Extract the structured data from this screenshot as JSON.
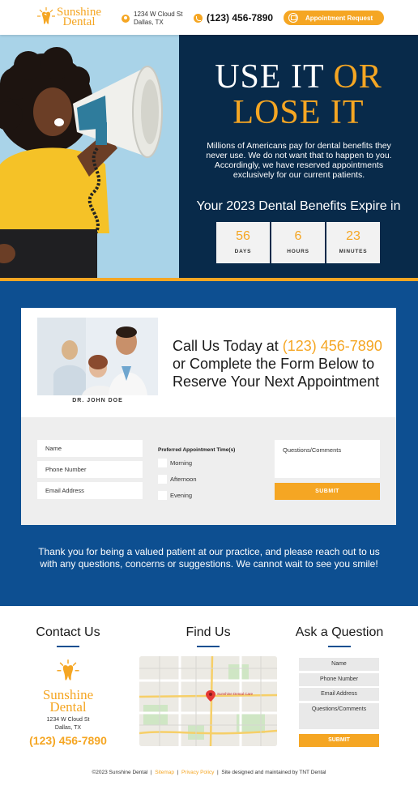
{
  "header": {
    "logo_line1": "Sunshine",
    "logo_line2": "Dental",
    "address_line1": "1234 W Cloud St",
    "address_line2": "Dallas, TX",
    "phone": "(123) 456-7890",
    "appointment_button": "Appointment Request"
  },
  "hero": {
    "title_part1": "USE IT ",
    "title_part2": "OR",
    "title_part3": "LOSE IT",
    "body": "Millions of Americans pay for dental benefits they never use. We do not want that to happen to you. Accordingly, we have reserved appointments exclusively for our current patients.",
    "expire_text": "Your 2023 Dental Benefits Expire in",
    "countdown": [
      {
        "value": "56",
        "label": "DAYS"
      },
      {
        "value": "6",
        "label": "HOURS"
      },
      {
        "value": "23",
        "label": "MINUTES"
      }
    ]
  },
  "appointment": {
    "doctor_label": "DR. JOHN DOE",
    "heading_prefix": "Call Us Today at ",
    "heading_phone": "(123) 456-7890",
    "heading_rest": "or Complete the Form Below to Reserve Your Next Appointment",
    "form": {
      "name_placeholder": "Name",
      "phone_placeholder": "Phone Number",
      "email_placeholder": "Email Address",
      "pref_title": "Preferred Appointment Time(s)",
      "options": [
        "Morning",
        "Afternoon",
        "Evening"
      ],
      "comments_placeholder": "Questions/Comments",
      "submit": "SUBMIT"
    },
    "thanks": "Thank you for being a valued patient at our practice, and please reach out to us with any questions, concerns or suggestions. We cannot wait to see you smile!"
  },
  "contact": {
    "title": "Contact Us",
    "logo_line1": "Sunshine",
    "logo_line2": "Dental",
    "address_line1": "1234 W Cloud St",
    "address_line2": "Dallas, TX",
    "phone": "(123) 456-7890"
  },
  "find": {
    "title": "Find Us",
    "map_marker_label": "Sunshine Dental Care"
  },
  "ask": {
    "title": "Ask a Question",
    "name": "Name",
    "phone": "Phone Number",
    "email": "Email Address",
    "comments": "Questions/Comments",
    "submit": "SUBMIT"
  },
  "footer": {
    "copyright": "©2023 Sunshine Dental",
    "sitemap": "Sitemap",
    "privacy": "Privacy Policy",
    "credit": "Site designed and maintained by TNT Dental"
  },
  "colors": {
    "accent": "#f5a623",
    "navy": "#082a4a",
    "blue": "#0d4f91"
  }
}
